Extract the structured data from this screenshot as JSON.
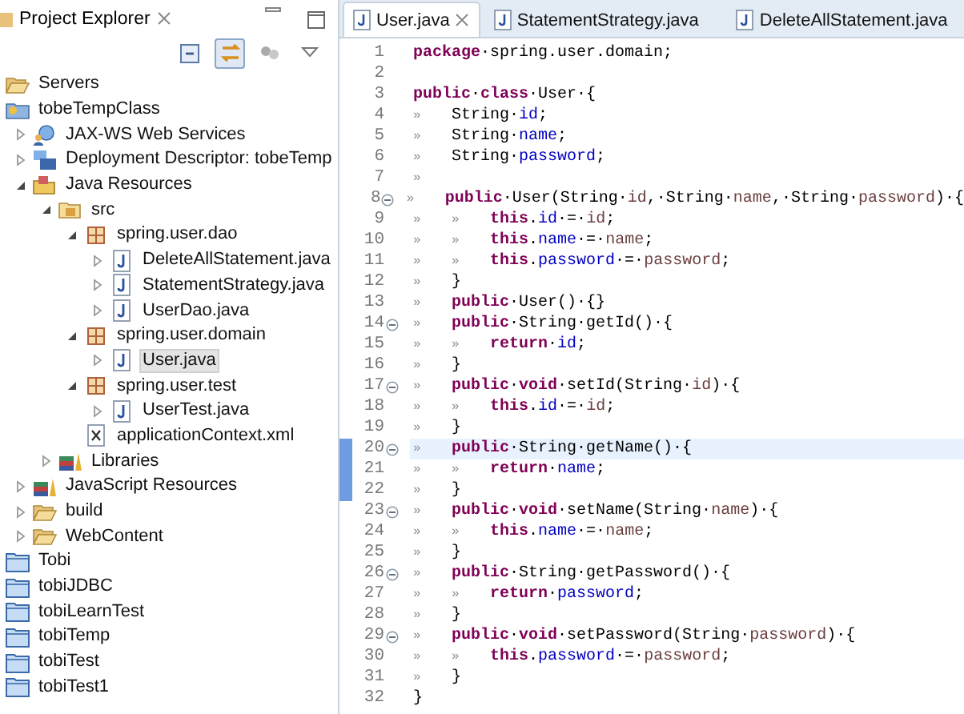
{
  "explorer": {
    "title": "Project Explorer",
    "toolbar": [
      {
        "kind": "collapse",
        "pressed": false
      },
      {
        "kind": "link",
        "pressed": true
      },
      {
        "kind": "filter",
        "pressed": false
      },
      {
        "kind": "menu",
        "pressed": false
      }
    ],
    "tree": [
      {
        "label": "Servers",
        "kind": "folder-open",
        "selected": false
      },
      {
        "label": "tobeTempClass",
        "kind": "project",
        "selected": false,
        "children": [
          {
            "label": "JAX-WS Web Services",
            "kind": "webservices",
            "expanded": false,
            "selected": false
          },
          {
            "label": "Deployment Descriptor: tobeTemp",
            "kind": "descriptor",
            "expanded": false,
            "selected": false
          },
          {
            "label": "Java Resources",
            "kind": "resources",
            "expanded": true,
            "selected": false,
            "children": [
              {
                "label": "src",
                "kind": "srcfolder",
                "expanded": true,
                "selected": false,
                "children": [
                  {
                    "label": "spring.user.dao",
                    "kind": "package",
                    "expanded": true,
                    "selected": false,
                    "children": [
                      {
                        "label": "DeleteAllStatement.java",
                        "kind": "java",
                        "expanded": false,
                        "selected": false
                      },
                      {
                        "label": "StatementStrategy.java",
                        "kind": "java",
                        "expanded": false,
                        "selected": false
                      },
                      {
                        "label": "UserDao.java",
                        "kind": "java",
                        "expanded": false,
                        "selected": false
                      }
                    ]
                  },
                  {
                    "label": "spring.user.domain",
                    "kind": "package",
                    "expanded": true,
                    "selected": false,
                    "children": [
                      {
                        "label": "User.java",
                        "kind": "java",
                        "expanded": false,
                        "selected": true
                      }
                    ]
                  },
                  {
                    "label": "spring.user.test",
                    "kind": "package",
                    "expanded": true,
                    "selected": false,
                    "children": [
                      {
                        "label": "UserTest.java",
                        "kind": "java",
                        "expanded": false,
                        "selected": false
                      }
                    ]
                  },
                  {
                    "label": "applicationContext.xml",
                    "kind": "xml",
                    "selected": false
                  }
                ]
              },
              {
                "label": "Libraries",
                "kind": "library",
                "expanded": false,
                "selected": false
              }
            ]
          },
          {
            "label": "JavaScript Resources",
            "kind": "library",
            "expanded": false,
            "selected": false
          },
          {
            "label": "build",
            "kind": "folder-open",
            "expanded": false,
            "selected": false
          },
          {
            "label": "WebContent",
            "kind": "folder-open",
            "expanded": false,
            "selected": false
          }
        ]
      },
      {
        "label": "Tobi",
        "kind": "closed-project",
        "selected": false
      },
      {
        "label": "tobiJDBC",
        "kind": "closed-project",
        "selected": false
      },
      {
        "label": "tobiLearnTest",
        "kind": "closed-project",
        "selected": false
      },
      {
        "label": "tobiTemp",
        "kind": "closed-project",
        "selected": false
      },
      {
        "label": "tobiTest",
        "kind": "closed-project",
        "selected": false
      },
      {
        "label": "tobiTest1",
        "kind": "closed-project",
        "selected": false
      }
    ]
  },
  "editor": {
    "tabs": [
      {
        "label": "User.java",
        "selected": true
      },
      {
        "label": "StatementStrategy.java",
        "selected": false
      },
      {
        "label": "DeleteAllStatement.java",
        "selected": false
      }
    ],
    "lines": [
      {
        "number": "1",
        "fold": false,
        "current": false,
        "in_range": false,
        "tokens": [
          {
            "kind": "kw",
            "text": "package"
          },
          {
            "kind": "plain",
            "text": "·spring.user.domain;"
          }
        ]
      },
      {
        "number": "2",
        "fold": false,
        "current": false,
        "in_range": false
      },
      {
        "number": "3",
        "fold": false,
        "current": false,
        "in_range": false,
        "tokens": [
          {
            "kind": "kw",
            "text": "public"
          },
          {
            "kind": "plain",
            "text": "·"
          },
          {
            "kind": "kw",
            "text": "class"
          },
          {
            "kind": "plain",
            "text": "·User·{"
          }
        ]
      },
      {
        "number": "4",
        "fold": false,
        "current": false,
        "in_range": false,
        "tokens": [
          {
            "kind": "tab",
            "text": "»"
          },
          {
            "kind": "plain",
            "text": "String·"
          },
          {
            "kind": "field",
            "text": "id"
          },
          {
            "kind": "plain",
            "text": ";"
          }
        ]
      },
      {
        "number": "5",
        "fold": false,
        "current": false,
        "in_range": false,
        "tokens": [
          {
            "kind": "tab",
            "text": "»"
          },
          {
            "kind": "plain",
            "text": "String·"
          },
          {
            "kind": "field",
            "text": "name"
          },
          {
            "kind": "plain",
            "text": ";"
          }
        ]
      },
      {
        "number": "6",
        "fold": false,
        "current": false,
        "in_range": false,
        "tokens": [
          {
            "kind": "tab",
            "text": "»"
          },
          {
            "kind": "plain",
            "text": "String·"
          },
          {
            "kind": "field",
            "text": "password"
          },
          {
            "kind": "plain",
            "text": ";"
          }
        ]
      },
      {
        "number": "7",
        "fold": false,
        "current": false,
        "in_range": false,
        "tokens": [
          {
            "kind": "tab",
            "text": "»"
          }
        ]
      },
      {
        "number": "8",
        "fold": true,
        "current": false,
        "in_range": false,
        "tokens": [
          {
            "kind": "tab",
            "text": "»"
          },
          {
            "kind": "kw",
            "text": "public"
          },
          {
            "kind": "plain",
            "text": "·User(String·"
          },
          {
            "kind": "var",
            "text": "id"
          },
          {
            "kind": "plain",
            "text": ",·String·"
          },
          {
            "kind": "var",
            "text": "name"
          },
          {
            "kind": "plain",
            "text": ",·String·"
          },
          {
            "kind": "var",
            "text": "password"
          },
          {
            "kind": "plain",
            "text": ")·{"
          }
        ]
      },
      {
        "number": "9",
        "fold": false,
        "current": false,
        "in_range": false,
        "tokens": [
          {
            "kind": "tab",
            "text": "»"
          },
          {
            "kind": "tab",
            "text": "»"
          },
          {
            "kind": "kw",
            "text": "this"
          },
          {
            "kind": "plain",
            "text": "."
          },
          {
            "kind": "field",
            "text": "id"
          },
          {
            "kind": "plain",
            "text": "·=·"
          },
          {
            "kind": "var",
            "text": "id"
          },
          {
            "kind": "plain",
            "text": ";"
          }
        ]
      },
      {
        "number": "10",
        "fold": false,
        "current": false,
        "in_range": false,
        "tokens": [
          {
            "kind": "tab",
            "text": "»"
          },
          {
            "kind": "tab",
            "text": "»"
          },
          {
            "kind": "kw",
            "text": "this"
          },
          {
            "kind": "plain",
            "text": "."
          },
          {
            "kind": "field",
            "text": "name"
          },
          {
            "kind": "plain",
            "text": "·=·"
          },
          {
            "kind": "var",
            "text": "name"
          },
          {
            "kind": "plain",
            "text": ";"
          }
        ]
      },
      {
        "number": "11",
        "fold": false,
        "current": false,
        "in_range": false,
        "tokens": [
          {
            "kind": "tab",
            "text": "»"
          },
          {
            "kind": "tab",
            "text": "»"
          },
          {
            "kind": "kw",
            "text": "this"
          },
          {
            "kind": "plain",
            "text": "."
          },
          {
            "kind": "field",
            "text": "password"
          },
          {
            "kind": "plain",
            "text": "·=·"
          },
          {
            "kind": "var",
            "text": "password"
          },
          {
            "kind": "plain",
            "text": ";"
          }
        ]
      },
      {
        "number": "12",
        "fold": false,
        "current": false,
        "in_range": false,
        "tokens": [
          {
            "kind": "tab",
            "text": "»"
          },
          {
            "kind": "plain",
            "text": "}"
          }
        ]
      },
      {
        "number": "13",
        "fold": false,
        "current": false,
        "in_range": false,
        "tokens": [
          {
            "kind": "tab",
            "text": "»"
          },
          {
            "kind": "kw",
            "text": "public"
          },
          {
            "kind": "plain",
            "text": "·User()·{}"
          }
        ]
      },
      {
        "number": "14",
        "fold": true,
        "current": false,
        "in_range": false,
        "tokens": [
          {
            "kind": "tab",
            "text": "»"
          },
          {
            "kind": "kw",
            "text": "public"
          },
          {
            "kind": "plain",
            "text": "·String·getId()·{"
          }
        ]
      },
      {
        "number": "15",
        "fold": false,
        "current": false,
        "in_range": false,
        "tokens": [
          {
            "kind": "tab",
            "text": "»"
          },
          {
            "kind": "tab",
            "text": "»"
          },
          {
            "kind": "kw",
            "text": "return"
          },
          {
            "kind": "plain",
            "text": "·"
          },
          {
            "kind": "field",
            "text": "id"
          },
          {
            "kind": "plain",
            "text": ";"
          }
        ]
      },
      {
        "number": "16",
        "fold": false,
        "current": false,
        "in_range": false,
        "tokens": [
          {
            "kind": "tab",
            "text": "»"
          },
          {
            "kind": "plain",
            "text": "}"
          }
        ]
      },
      {
        "number": "17",
        "fold": true,
        "current": false,
        "in_range": false,
        "tokens": [
          {
            "kind": "tab",
            "text": "»"
          },
          {
            "kind": "kw",
            "text": "public"
          },
          {
            "kind": "plain",
            "text": "·"
          },
          {
            "kind": "kw",
            "text": "void"
          },
          {
            "kind": "plain",
            "text": "·setId(String·"
          },
          {
            "kind": "var",
            "text": "id"
          },
          {
            "kind": "plain",
            "text": ")·{"
          }
        ]
      },
      {
        "number": "18",
        "fold": false,
        "current": false,
        "in_range": false,
        "tokens": [
          {
            "kind": "tab",
            "text": "»"
          },
          {
            "kind": "tab",
            "text": "»"
          },
          {
            "kind": "kw",
            "text": "this"
          },
          {
            "kind": "plain",
            "text": "."
          },
          {
            "kind": "field",
            "text": "id"
          },
          {
            "kind": "plain",
            "text": "·=·"
          },
          {
            "kind": "var",
            "text": "id"
          },
          {
            "kind": "plain",
            "text": ";"
          }
        ]
      },
      {
        "number": "19",
        "fold": false,
        "current": false,
        "in_range": false,
        "tokens": [
          {
            "kind": "tab",
            "text": "»"
          },
          {
            "kind": "plain",
            "text": "}"
          }
        ]
      },
      {
        "number": "20",
        "fold": true,
        "current": true,
        "in_range": true,
        "tokens": [
          {
            "kind": "tab",
            "text": "»"
          },
          {
            "kind": "kw",
            "text": "public"
          },
          {
            "kind": "plain",
            "text": "·String·getName()·{"
          }
        ]
      },
      {
        "number": "21",
        "fold": false,
        "current": false,
        "in_range": true,
        "tokens": [
          {
            "kind": "tab",
            "text": "»"
          },
          {
            "kind": "tab",
            "text": "»"
          },
          {
            "kind": "kw",
            "text": "return"
          },
          {
            "kind": "plain",
            "text": "·"
          },
          {
            "kind": "field",
            "text": "name"
          },
          {
            "kind": "plain",
            "text": ";"
          }
        ]
      },
      {
        "number": "22",
        "fold": false,
        "current": false,
        "in_range": true,
        "tokens": [
          {
            "kind": "tab",
            "text": "»"
          },
          {
            "kind": "plain",
            "text": "}"
          }
        ]
      },
      {
        "number": "23",
        "fold": true,
        "current": false,
        "in_range": false,
        "tokens": [
          {
            "kind": "tab",
            "text": "»"
          },
          {
            "kind": "kw",
            "text": "public"
          },
          {
            "kind": "plain",
            "text": "·"
          },
          {
            "kind": "kw",
            "text": "void"
          },
          {
            "kind": "plain",
            "text": "·setName(String·"
          },
          {
            "kind": "var",
            "text": "name"
          },
          {
            "kind": "plain",
            "text": ")·{"
          }
        ]
      },
      {
        "number": "24",
        "fold": false,
        "current": false,
        "in_range": false,
        "tokens": [
          {
            "kind": "tab",
            "text": "»"
          },
          {
            "kind": "tab",
            "text": "»"
          },
          {
            "kind": "kw",
            "text": "this"
          },
          {
            "kind": "plain",
            "text": "."
          },
          {
            "kind": "field",
            "text": "name"
          },
          {
            "kind": "plain",
            "text": "·=·"
          },
          {
            "kind": "var",
            "text": "name"
          },
          {
            "kind": "plain",
            "text": ";"
          }
        ]
      },
      {
        "number": "25",
        "fold": false,
        "current": false,
        "in_range": false,
        "tokens": [
          {
            "kind": "tab",
            "text": "»"
          },
          {
            "kind": "plain",
            "text": "}"
          }
        ]
      },
      {
        "number": "26",
        "fold": true,
        "current": false,
        "in_range": false,
        "tokens": [
          {
            "kind": "tab",
            "text": "»"
          },
          {
            "kind": "kw",
            "text": "public"
          },
          {
            "kind": "plain",
            "text": "·String·getPassword()·{"
          }
        ]
      },
      {
        "number": "27",
        "fold": false,
        "current": false,
        "in_range": false,
        "tokens": [
          {
            "kind": "tab",
            "text": "»"
          },
          {
            "kind": "tab",
            "text": "»"
          },
          {
            "kind": "kw",
            "text": "return"
          },
          {
            "kind": "plain",
            "text": "·"
          },
          {
            "kind": "field",
            "text": "password"
          },
          {
            "kind": "plain",
            "text": ";"
          }
        ]
      },
      {
        "number": "28",
        "fold": false,
        "current": false,
        "in_range": false,
        "tokens": [
          {
            "kind": "tab",
            "text": "»"
          },
          {
            "kind": "plain",
            "text": "}"
          }
        ]
      },
      {
        "number": "29",
        "fold": true,
        "current": false,
        "in_range": false,
        "tokens": [
          {
            "kind": "tab",
            "text": "»"
          },
          {
            "kind": "kw",
            "text": "public"
          },
          {
            "kind": "plain",
            "text": "·"
          },
          {
            "kind": "kw",
            "text": "void"
          },
          {
            "kind": "plain",
            "text": "·setPassword(String·"
          },
          {
            "kind": "var",
            "text": "password"
          },
          {
            "kind": "plain",
            "text": ")·{"
          }
        ]
      },
      {
        "number": "30",
        "fold": false,
        "current": false,
        "in_range": false,
        "tokens": [
          {
            "kind": "tab",
            "text": "»"
          },
          {
            "kind": "tab",
            "text": "»"
          },
          {
            "kind": "kw",
            "text": "this"
          },
          {
            "kind": "plain",
            "text": "."
          },
          {
            "kind": "field",
            "text": "password"
          },
          {
            "kind": "plain",
            "text": "·=·"
          },
          {
            "kind": "var",
            "text": "password"
          },
          {
            "kind": "plain",
            "text": ";"
          }
        ]
      },
      {
        "number": "31",
        "fold": false,
        "current": false,
        "in_range": false,
        "tokens": [
          {
            "kind": "tab",
            "text": "»"
          },
          {
            "kind": "plain",
            "text": "}"
          }
        ]
      },
      {
        "number": "32",
        "fold": false,
        "current": false,
        "in_range": false,
        "tokens": [
          {
            "kind": "plain",
            "text": "}"
          }
        ]
      }
    ]
  }
}
